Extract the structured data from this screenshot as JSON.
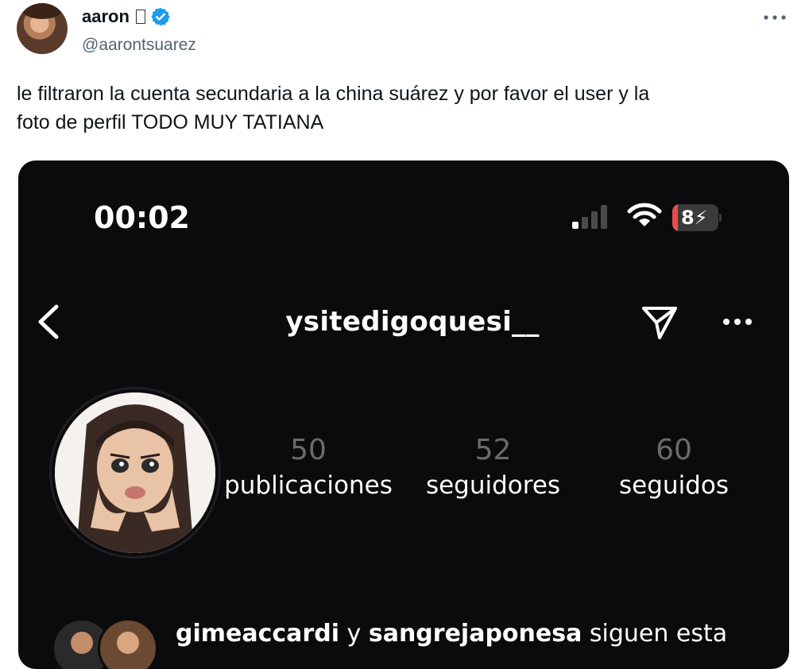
{
  "tweet": {
    "author_name": "aaron",
    "author_handle": "@aarontsuarez",
    "text_line1": "le filtraron la cuenta secundaria a la china suárez y por favor el user y la",
    "text_line2": "foto de perfil TODO MUY TATIANA",
    "more_icon": "more-horizontal-icon",
    "verified_color": "#1d9bf0"
  },
  "screenshot": {
    "status_bar": {
      "time": "00:02",
      "battery": "8"
    },
    "header": {
      "username": "ysitedigoquesi__"
    },
    "stats": {
      "posts_count": "50",
      "posts_label": "publicaciones",
      "followers_count": "52",
      "followers_label": "seguidores",
      "following_count": "60",
      "following_label": "seguidos"
    },
    "followed_by": {
      "user1": "gimeaccardi",
      "connector": "y",
      "user2": "sangrejaponesa",
      "suffix": "siguen esta"
    }
  }
}
